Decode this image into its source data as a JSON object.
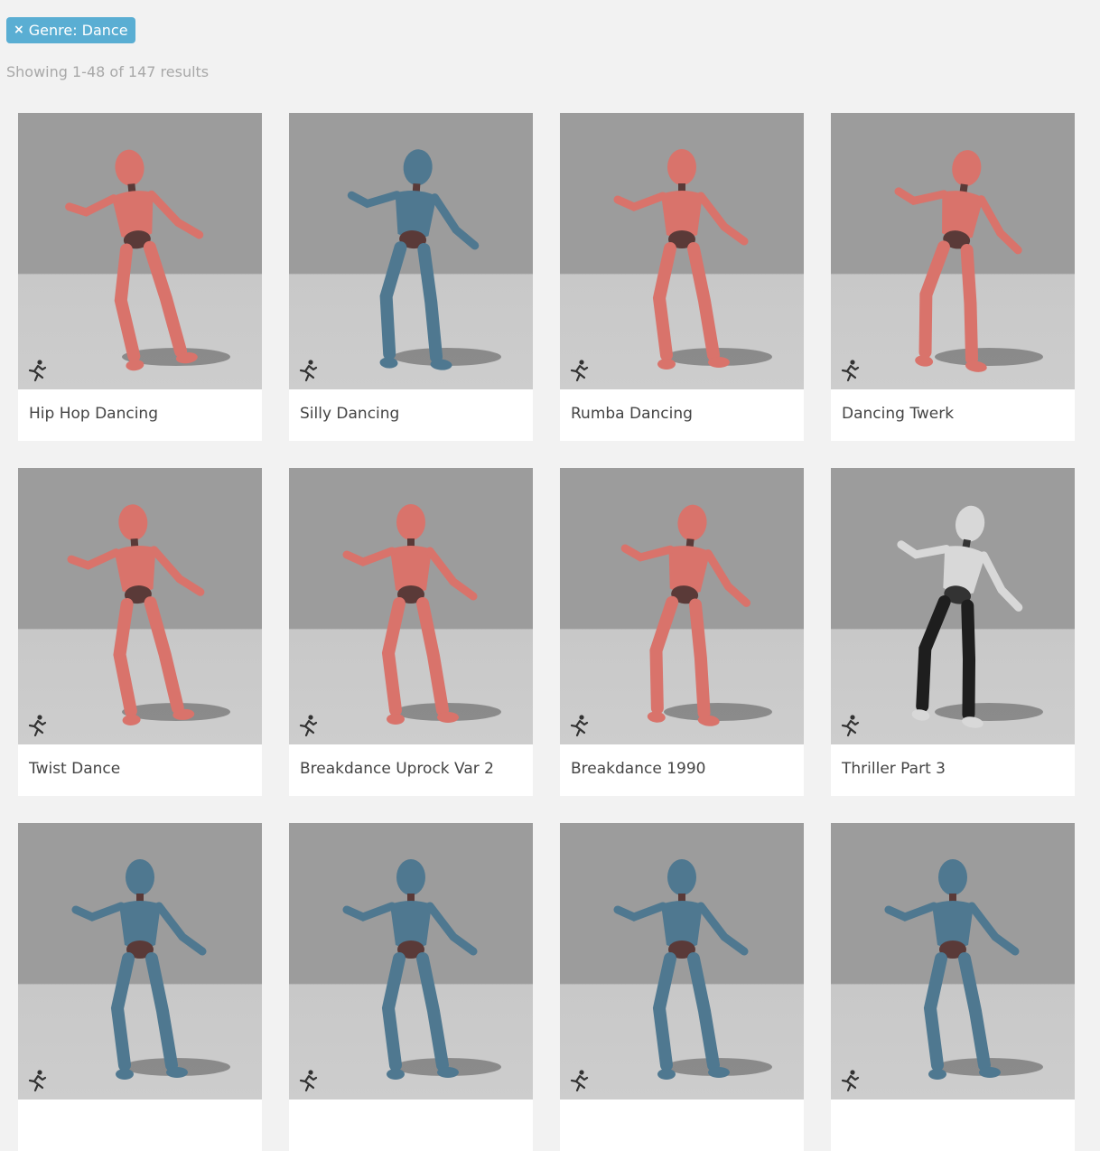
{
  "filter": {
    "remove_symbol": "×",
    "label": "Genre: Dance"
  },
  "results_text": "Showing 1-48 of 147 results",
  "colors": {
    "chip": "#5aaed3",
    "mannequin_red": "#d9736b",
    "mannequin_blue": "#4f7890",
    "human_shirt": "#d8d8d8",
    "human_pants": "#1e1e1e"
  },
  "icons": {
    "animation_badge": "running-figure-icon",
    "remove_filter": "close-icon"
  },
  "cards": [
    {
      "title": "Hip Hop Dancing",
      "model": "red"
    },
    {
      "title": "Silly Dancing",
      "model": "blue"
    },
    {
      "title": "Rumba Dancing",
      "model": "red"
    },
    {
      "title": "Dancing Twerk",
      "model": "red"
    },
    {
      "title": "Twist Dance",
      "model": "red"
    },
    {
      "title": "Breakdance Uprock Var 2",
      "model": "red"
    },
    {
      "title": "Breakdance 1990",
      "model": "red"
    },
    {
      "title": "Thriller Part 3",
      "model": "human"
    },
    {
      "title": "",
      "model": "blue"
    },
    {
      "title": "",
      "model": "blue"
    },
    {
      "title": "",
      "model": "blue"
    },
    {
      "title": "",
      "model": "blue"
    }
  ]
}
